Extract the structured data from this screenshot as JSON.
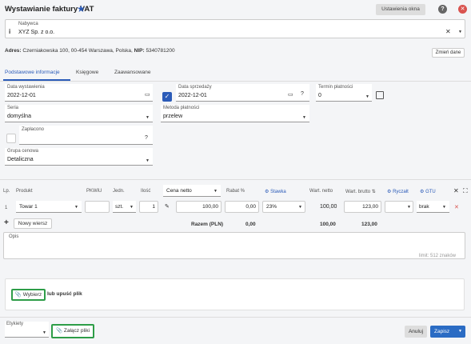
{
  "header": {
    "title": "Wystawianie faktury VAT",
    "settings_label": "Ustawienia okna"
  },
  "buyer": {
    "label": "Nabywca",
    "value": "XYZ Sp. z o.o.",
    "address_label": "Adres:",
    "address": "Czerniakowska 100, 00-454 Warszawa, Polska,",
    "nip_label": "NIP:",
    "nip": "5340781200",
    "change_label": "Zmień dane"
  },
  "tabs": [
    "Podstawowe informacje",
    "Księgowe",
    "Zaawansowane"
  ],
  "form": {
    "issue_date_label": "Data wystawienia",
    "issue_date": "2022-12-01",
    "sale_date_label": "Data sprzedaży",
    "sale_date": "2022-12-01",
    "payment_term_label": "Termin płatności",
    "payment_term": "0",
    "series_label": "Seria",
    "series": "domyślna",
    "payment_method_label": "Metoda płatności",
    "payment_method": "przelew",
    "paid_label": "Zapłacono",
    "price_group_label": "Grupa cenowa",
    "price_group": "Detaliczna"
  },
  "table": {
    "headers": {
      "lp": "Lp.",
      "product": "Produkt",
      "pkwiu": "PKWiU",
      "unit": "Jedn.",
      "qty": "Ilość",
      "price_type": "Cena netto",
      "discount": "Rabat %",
      "rate": "Stawka",
      "net": "Wart. netto",
      "gross": "Wart. brutto",
      "lump": "Ryczałt",
      "gtu": "GTU"
    },
    "row": {
      "lp": "1",
      "product": "Towar 1",
      "unit": "szt.",
      "qty": "1",
      "price": "100,00",
      "discount": "0,00",
      "rate": "23%",
      "net": "100,00",
      "gross": "123,00",
      "gtu": "brak"
    },
    "add_row": "Nowy wiersz",
    "sum_label": "Razem (PLN)",
    "sum_discount": "0,00",
    "sum_net": "100,00",
    "sum_gross": "123,00"
  },
  "description": {
    "label": "Opis",
    "limit": "limit: 512 znaków"
  },
  "attach": {
    "choose_label": "Wybierz",
    "drop_label": "lub upuść plik"
  },
  "footer": {
    "tags_label": "Etykiety",
    "attach_files_label": "Załącz pliki",
    "cancel_label": "Anuluj",
    "save_label": "Zapisz"
  }
}
